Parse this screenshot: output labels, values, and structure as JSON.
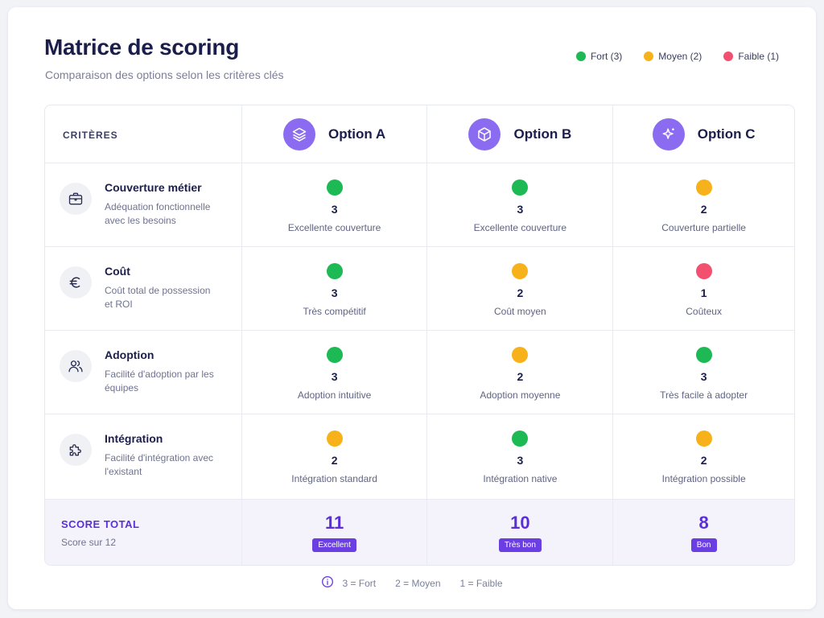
{
  "header": {
    "title": "Matrice de scoring",
    "subtitle": "Comparaison des options selon les critères clés"
  },
  "legend": [
    {
      "label": "Fort (3)",
      "color": "#1db954"
    },
    {
      "label": "Moyen (2)",
      "color": "#f7b21b"
    },
    {
      "label": "Faible (1)",
      "color": "#f2506e"
    }
  ],
  "colors": {
    "fort": "#1db954",
    "moyen": "#f7b21b",
    "faible": "#f2506e",
    "accent": "#5b2fd6",
    "option_icon_bg": "#8b6cf0"
  },
  "table": {
    "criteria_header": "CRITÈRES",
    "options": [
      {
        "name": "Option A",
        "icon": "layers-icon"
      },
      {
        "name": "Option B",
        "icon": "cube-icon"
      },
      {
        "name": "Option C",
        "icon": "sparkle-icon"
      }
    ],
    "criteria": [
      {
        "name": "Couverture métier",
        "desc": "Adéquation fonctionnelle avec les besoins",
        "icon": "briefcase-icon",
        "scores": [
          {
            "value": "3",
            "label": "Excellente couverture",
            "level": "fort"
          },
          {
            "value": "3",
            "label": "Excellente couverture",
            "level": "fort"
          },
          {
            "value": "2",
            "label": "Couverture partielle",
            "level": "moyen"
          }
        ]
      },
      {
        "name": "Coût",
        "desc": "Coût total de possession et ROI",
        "icon": "euro-icon",
        "scores": [
          {
            "value": "3",
            "label": "Très compétitif",
            "level": "fort"
          },
          {
            "value": "2",
            "label": "Coût moyen",
            "level": "moyen"
          },
          {
            "value": "1",
            "label": "Coûteux",
            "level": "faible"
          }
        ]
      },
      {
        "name": "Adoption",
        "desc": "Facilité d'adoption par les équipes",
        "icon": "users-icon",
        "scores": [
          {
            "value": "3",
            "label": "Adoption intuitive",
            "level": "fort"
          },
          {
            "value": "2",
            "label": "Adoption moyenne",
            "level": "moyen"
          },
          {
            "value": "3",
            "label": "Très facile à adopter",
            "level": "fort"
          }
        ]
      },
      {
        "name": "Intégration",
        "desc": "Facilité d'intégration avec l'existant",
        "icon": "puzzle-icon",
        "scores": [
          {
            "value": "2",
            "label": "Intégration standard",
            "level": "moyen"
          },
          {
            "value": "3",
            "label": "Intégration native",
            "level": "fort"
          },
          {
            "value": "2",
            "label": "Intégration possible",
            "level": "moyen"
          }
        ]
      }
    ],
    "total": {
      "label": "SCORE TOTAL",
      "sub": "Score sur 12",
      "values": [
        {
          "value": "11",
          "badge": "Excellent"
        },
        {
          "value": "10",
          "badge": "Très bon"
        },
        {
          "value": "8",
          "badge": "Bon"
        }
      ]
    }
  },
  "footer": {
    "icon": "info-icon",
    "items": [
      "3 = Fort",
      "2 = Moyen",
      "1 = Faible"
    ]
  }
}
